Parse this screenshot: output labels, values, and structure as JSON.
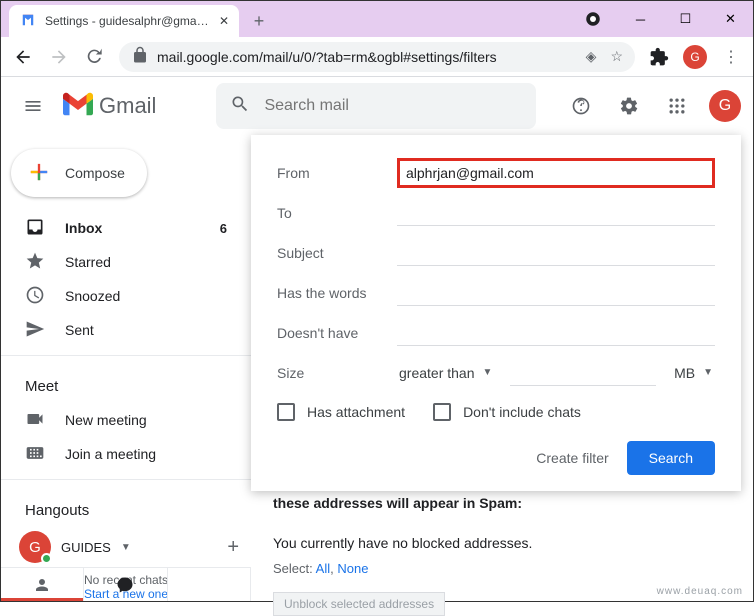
{
  "browser": {
    "tab_title": "Settings - guidesalphr@gmail.co",
    "url": "mail.google.com/mail/u/0/?tab=rm&ogbl#settings/filters"
  },
  "header": {
    "app_name": "Gmail",
    "search_placeholder": "Search mail",
    "profile_letter": "G"
  },
  "sidebar": {
    "compose": "Compose",
    "items": [
      {
        "label": "Inbox",
        "count": "6"
      },
      {
        "label": "Starred"
      },
      {
        "label": "Snoozed"
      },
      {
        "label": "Sent"
      }
    ],
    "meet_heading": "Meet",
    "meet": [
      {
        "label": "New meeting"
      },
      {
        "label": "Join a meeting"
      }
    ],
    "hangouts_heading": "Hangouts",
    "hangouts_user_initial": "G",
    "hangouts_user": "GUIDES",
    "no_recent": "No recent chats",
    "start_new": "Start a new one"
  },
  "filter": {
    "labels": {
      "from": "From",
      "to": "To",
      "subject": "Subject",
      "has_words": "Has the words",
      "doesnt_have": "Doesn't have",
      "size": "Size"
    },
    "from_value": "alphrjan@gmail.com",
    "size_op": "greater than",
    "size_unit": "MB",
    "has_attachment": "Has attachment",
    "dont_include": "Don't include chats",
    "create_filter": "Create filter",
    "search": "Search"
  },
  "behind": {
    "spam_line": "these addresses will appear in Spam:",
    "no_blocked": "You currently have no blocked addresses.",
    "select": "Select:",
    "all": "All",
    "none": "None",
    "unblock": "Unblock selected addresses"
  },
  "watermark": "www.deuaq.com"
}
